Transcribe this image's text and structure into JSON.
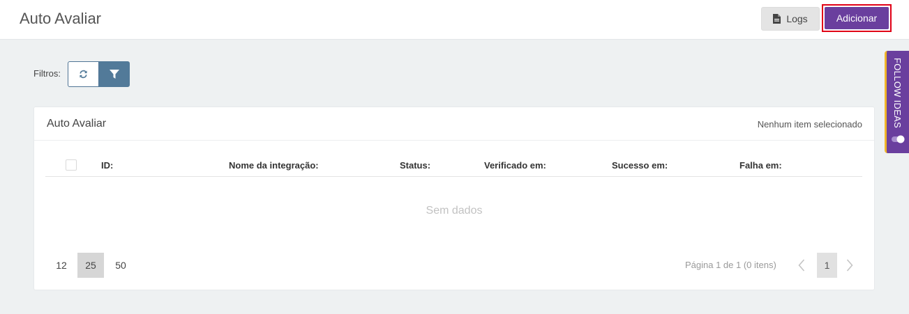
{
  "header": {
    "title": "Auto Avaliar",
    "logs_label": "Logs",
    "add_label": "Adicionar"
  },
  "filters": {
    "label": "Filtros:",
    "refresh_icon": "refresh-icon",
    "filter_icon": "filter-icon"
  },
  "panel": {
    "title": "Auto Avaliar",
    "selection_status": "Nenhum item selecionado",
    "columns": [
      "ID:",
      "Nome da integração:",
      "Status:",
      "Verificado em:",
      "Sucesso em:",
      "Falha em:"
    ],
    "empty_message": "Sem dados"
  },
  "pagination": {
    "page_sizes": [
      "12",
      "25",
      "50"
    ],
    "active_page_size": "25",
    "info": "Página 1 de 1 (0 itens)",
    "current_page": "1"
  },
  "side_tab": {
    "label": "FOLLOW IDEAS"
  },
  "colors": {
    "primary": "#6a3f9e",
    "highlight_outline": "#e00016",
    "filter_button": "#527a99",
    "side_tab_accent": "#f0b429"
  }
}
